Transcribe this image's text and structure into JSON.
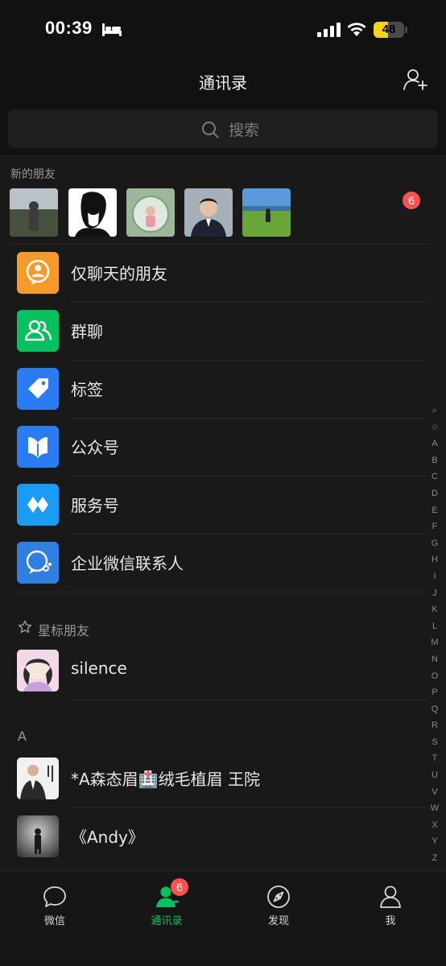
{
  "status_bar": {
    "time": "00:39",
    "battery": "48",
    "battery_level": 0.48
  },
  "nav": {
    "title": "通讯录"
  },
  "search": {
    "placeholder": "搜索"
  },
  "new_friends": {
    "label": "新的朋友",
    "badge": "6"
  },
  "menu_items": [
    {
      "label": "仅聊天的朋友",
      "color": "#f79a2b",
      "icon": "chat-only-friends-icon"
    },
    {
      "label": "群聊",
      "color": "#07c160",
      "icon": "group-chat-icon"
    },
    {
      "label": "标签",
      "color": "#2b7cf2",
      "icon": "tag-icon"
    },
    {
      "label": "公众号",
      "color": "#2b7cf2",
      "icon": "official-account-icon"
    },
    {
      "label": "服务号",
      "color": "#1a9cf5",
      "icon": "service-account-icon"
    },
    {
      "label": "企业微信联系人",
      "color": "#2e7fe0",
      "icon": "wecom-contacts-icon"
    }
  ],
  "starred": {
    "label": "星标朋友",
    "contacts": [
      {
        "name": "silence"
      }
    ]
  },
  "section_a": {
    "letter": "A",
    "contacts": [
      {
        "name": "*A森态眉🏥绒毛植眉 王院"
      },
      {
        "name": "《Andy》"
      }
    ]
  },
  "index": [
    "⌕",
    "☆",
    "A",
    "B",
    "C",
    "D",
    "E",
    "F",
    "G",
    "H",
    "I",
    "J",
    "K",
    "L",
    "M",
    "N",
    "O",
    "P",
    "Q",
    "R",
    "S",
    "T",
    "U",
    "V",
    "W",
    "X",
    "Y",
    "Z",
    "#"
  ],
  "tabs": [
    {
      "label": "微信",
      "icon": "chat-bubble-icon",
      "active": false
    },
    {
      "label": "通讯录",
      "icon": "contacts-icon",
      "active": true,
      "badge": "6"
    },
    {
      "label": "发现",
      "icon": "compass-icon",
      "active": false
    },
    {
      "label": "我",
      "icon": "person-icon",
      "active": false
    }
  ],
  "colors": {
    "accent": "#07c160",
    "badge": "#fa5151",
    "background": "#191919"
  }
}
